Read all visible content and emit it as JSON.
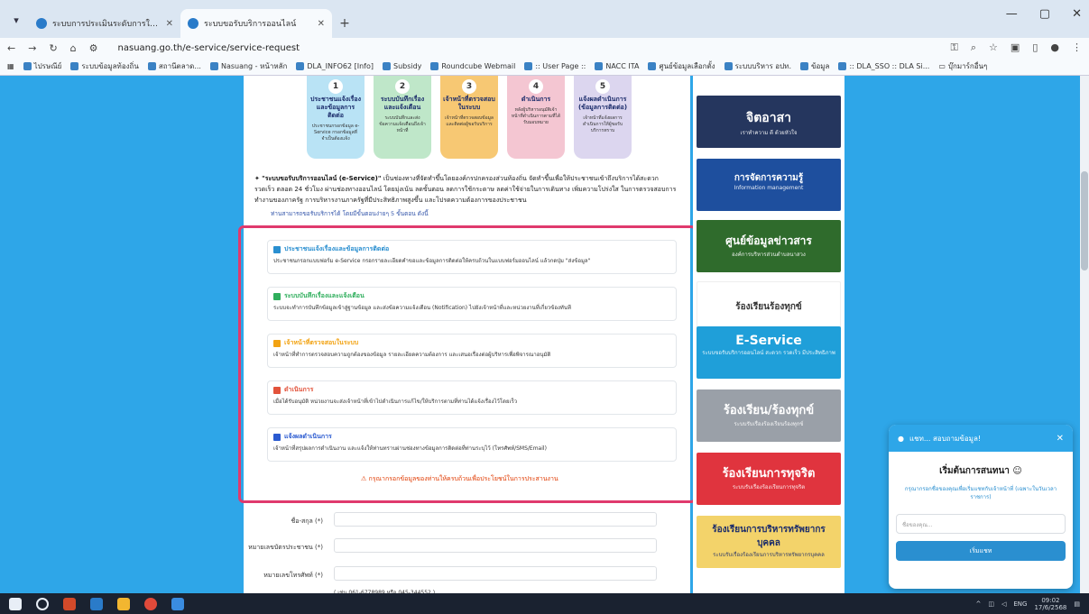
{
  "browser": {
    "tabs": [
      {
        "title": "ระบบการประเมินระดับการให้บริการ-ขอรับ..."
      },
      {
        "title": "ระบบขอรับบริการออนไลน์"
      }
    ],
    "url": "nasuang.go.th/e-service/service-request",
    "bookmarks": [
      "ไปรษณีย์",
      "ระบบข้อมูลท้องถิ่น",
      "สถานีตลาด...",
      "Nasuang - หน้าหลัก",
      "DLA_INFO62 [Info]",
      "Subsidy",
      "Roundcube Webmail",
      ":: User Page ::",
      "NACC ITA",
      "ศูนย์ข้อมูลเลือกตั้ง",
      "ระบบบริหาร อปท.",
      "ข้อมูล",
      ":: DLA_SSO :: DLA Si...",
      "บุ๊กมาร์กอื่นๆ"
    ]
  },
  "steps": [
    {
      "num": "1",
      "title": "ประชาชนแจ้งเรื่องและข้อมูลการติดต่อ",
      "desc": "ประชาชนกรอกข้อมูล e-Service กรอกข้อมูลที่จำเป็นต้องแจ้ง",
      "color": "#b9e3f5"
    },
    {
      "num": "2",
      "title": "ระบบบันทึกเรื่องและแจ้งเตือน",
      "desc": "ระบบบันทึกและส่งข้อความแจ้งเตือนถึงเจ้าหน้าที่",
      "color": "#bfe7c9"
    },
    {
      "num": "3",
      "title": "เจ้าหน้าที่ตรวจสอบในระบบ",
      "desc": "เจ้าหน้าที่ตรวจสอบข้อมูลและติดต่อผู้ขอรับบริการ",
      "color": "#f7c873"
    },
    {
      "num": "4",
      "title": "ดำเนินการ",
      "desc": "หลังผู้บริหารอนุมัติเจ้าหน้าที่ดำเนินการตามที่ได้รับมอบหมาย",
      "color": "#f4c6d2"
    },
    {
      "num": "5",
      "title": "แจ้งผลดำเนินการ (ข้อมูลการติดต่อ)",
      "desc": "เจ้าหน้าที่แจ้งผลการดำเนินการให้ผู้ขอรับบริการทราบ",
      "color": "#dcd6ef"
    }
  ],
  "intro": {
    "lead": "\"ระบบขอรับบริการออนไลน์ (e-Service)\"",
    "text": "เป็นช่องทางที่จัดทำขึ้นโดยองค์กรปกครองส่วนท้องถิ่น จัดทำขึ้นเพื่อให้ประชาชนเข้าถึงบริการได้สะดวก รวดเร็ว ตลอด 24 ชั่วโมง ผ่านช่องทางออนไลน์ โดยมุ่งเน้น ลดขั้นตอน ลดการใช้กระดาษ ลดค่าใช้จ่ายในการเดินทาง เพิ่มความโปร่งใส ในการตรวจสอบการทำงานของภาครัฐ การบริหารงานภาครัฐที่มีประสิทธิภาพสูงขึ้น และโปรดความต้องการของประชาชน",
    "sub": "ท่านสามารถขอรับบริการได้ โดยมีขั้นตอนง่ายๆ 5 ขั้นตอน ดังนี้"
  },
  "process_items": [
    {
      "title": "ประชาชนแจ้งเรื่องและข้อมูลการติดต่อ",
      "desc": "ประชาชนกรอกแบบฟอร์ม e-Service กรอกรายละเอียดคำขอและข้อมูลการติดต่อให้ครบถ้วนในแบบฟอร์มออนไลน์ แล้วกดปุ่ม \"ส่งข้อมูล\"",
      "color": "#2a8fd0"
    },
    {
      "title": "ระบบบันทึกเรื่องและแจ้งเตือน",
      "desc": "ระบบจะทำการบันทึกข้อมูลเข้าสู่ฐานข้อมูล และส่งข้อความแจ้งเตือน (Notification) ไปยังเจ้าหน้าที่และหน่วยงานที่เกี่ยวข้องทันที",
      "color": "#2fae5c"
    },
    {
      "title": "เจ้าหน้าที่ตรวจสอบในระบบ",
      "desc": "เจ้าหน้าที่ทำการตรวจสอบความถูกต้องของข้อมูล รายละเอียดความต้องการ และเสนอเรื่องต่อผู้บริหารเพื่อพิจารณาอนุมัติ",
      "color": "#f2a313"
    },
    {
      "title": "ดำเนินการ",
      "desc": "เมื่อได้รับอนุมัติ หน่วยงานจะส่งเจ้าหน้าที่เข้าไปดำเนินการแก้ไข/ให้บริการตามที่ท่านได้แจ้งเรื่องไว้โดยเร็ว",
      "color": "#e2533b"
    },
    {
      "title": "แจ้งผลดำเนินการ",
      "desc": "เจ้าหน้าที่สรุปผลการดำเนินงาน และแจ้งให้ท่านทราบผ่านช่องทางข้อมูลการติดต่อที่ท่านระบุไว้ (โทรศัพท์/SMS/Email)",
      "color": "#2a5ad0"
    }
  ],
  "warning": "กรุณากรอกข้อมูลของท่านให้ครบถ้วนเพื่อประโยชน์ในการประสานงาน",
  "form": {
    "name_label": "ชื่อ-สกุล (*)",
    "idcard_label": "หมายเลขบัตรประชาชน (*)",
    "phone_label": "หมายเลขโทรศัพท์ (*)",
    "phone_hint": "( เช่น 061-6778989 หรือ 045-344552 )"
  },
  "banners": [
    {
      "title": "จิตอาสา",
      "sub": "เราทำความ ดี ด้วยหัวใจ",
      "color": "#25365e"
    },
    {
      "title": "การจัดการความรู้",
      "sub": "Information management",
      "color": "#1e4f9e"
    },
    {
      "title": "ศูนย์ข้อมูลข่าวสาร",
      "sub": "องค์การบริหารส่วนตำบลนาสวง",
      "color": "#2f6b2c"
    },
    {
      "title": "ร้องเรียนร้องทุกข์",
      "sub": "",
      "color": "#ffffff"
    },
    {
      "title": "E-Service",
      "sub": "ระบบขอรับบริการออนไลน์ สะดวก รวดเร็ว มีประสิทธิภาพ",
      "color": "#1f9fd9"
    },
    {
      "title": "ร้องเรียน/ร้องทุกข์",
      "sub": "ระบบรับเรื่องร้องเรียนร้องทุกข์",
      "color": "#9aa0a8"
    },
    {
      "title": "ร้องเรียนการทุจริต",
      "sub": "ระบบรับเรื่องร้องเรียนการทุจริต",
      "color": "#e0343e"
    },
    {
      "title": "ร้องเรียนการบริหารทรัพยากรบุคคล",
      "sub": "ระบบรับเรื่องร้องเรียนการบริหารทรัพยากรบุคคล",
      "color": "#f3d36a"
    }
  ],
  "chat": {
    "header": "แชท... สอบถามข้อมูล!",
    "title": "เริ่มต้นการสนทนา",
    "subtitle": "กรุณากรอกชื่อของคุณเพื่อเริ่มแชทกับเจ้าหน้าที่ (เฉพาะในวันเวลาราชการ)",
    "name_placeholder": "ชื่อของคุณ...",
    "start_button": "เริ่มแชท"
  },
  "taskbar": {
    "lang": "ENG",
    "time": "09:02",
    "date": "17/6/2568"
  }
}
